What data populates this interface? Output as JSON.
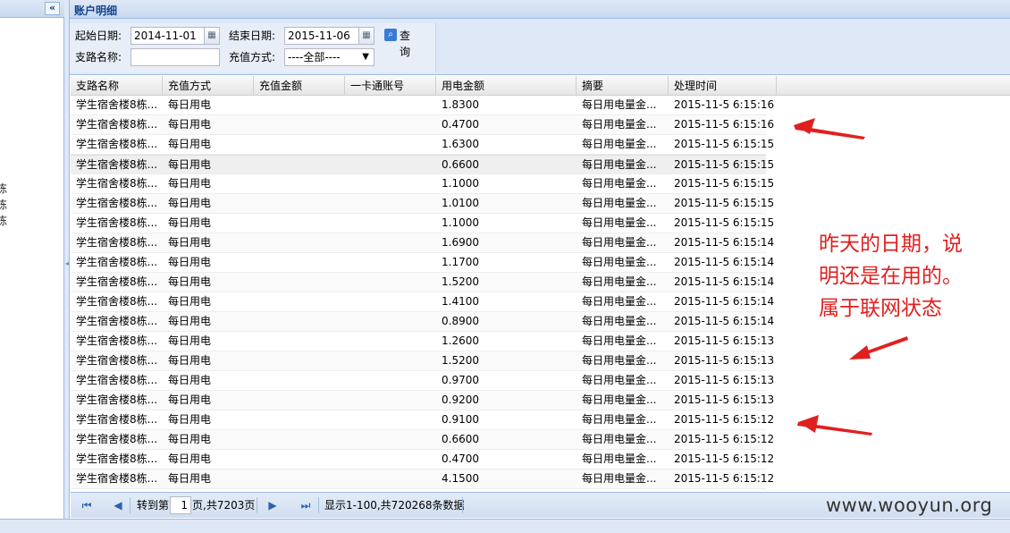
{
  "left_tree": {
    "collapse_icon": "double-chevron-left-icon",
    "items": [
      "",
      "",
      "",
      "",
      "",
      "",
      "",
      "",
      "",
      "",
      "栋",
      "栋",
      "栋"
    ]
  },
  "main": {
    "title": "账户明细"
  },
  "form": {
    "start_label": "起始日期:",
    "start_value": "2014-11-01",
    "end_label": "结束日期:",
    "end_value": "2015-11-06",
    "query_label": "查询",
    "branch_label": "支路名称:",
    "branch_value": "",
    "method_label": "充值方式:",
    "method_value": "----全部----",
    "calendar_icon": "calendar-icon",
    "search_icon": "search-icon"
  },
  "grid": {
    "columns": [
      "支路名称",
      "充值方式",
      "充值金额",
      "一卡通账号",
      "用电金额",
      "摘要",
      "处理时间"
    ],
    "rows": [
      [
        "学生宿舍楼8栋...",
        "每日用电",
        "",
        "",
        "1.8300",
        "每日用电量金...",
        "2015-11-5 6:15:16"
      ],
      [
        "学生宿舍楼8栋...",
        "每日用电",
        "",
        "",
        "0.4700",
        "每日用电量金...",
        "2015-11-5 6:15:16"
      ],
      [
        "学生宿舍楼8栋...",
        "每日用电",
        "",
        "",
        "1.6300",
        "每日用电量金...",
        "2015-11-5 6:15:15"
      ],
      [
        "学生宿舍楼8栋...",
        "每日用电",
        "",
        "",
        "0.6600",
        "每日用电量金...",
        "2015-11-5 6:15:15"
      ],
      [
        "学生宿舍楼8栋...",
        "每日用电",
        "",
        "",
        "1.1000",
        "每日用电量金...",
        "2015-11-5 6:15:15"
      ],
      [
        "学生宿舍楼8栋...",
        "每日用电",
        "",
        "",
        "1.0100",
        "每日用电量金...",
        "2015-11-5 6:15:15"
      ],
      [
        "学生宿舍楼8栋...",
        "每日用电",
        "",
        "",
        "1.1000",
        "每日用电量金...",
        "2015-11-5 6:15:15"
      ],
      [
        "学生宿舍楼8栋...",
        "每日用电",
        "",
        "",
        "1.6900",
        "每日用电量金...",
        "2015-11-5 6:15:14"
      ],
      [
        "学生宿舍楼8栋...",
        "每日用电",
        "",
        "",
        "1.1700",
        "每日用电量金...",
        "2015-11-5 6:15:14"
      ],
      [
        "学生宿舍楼8栋...",
        "每日用电",
        "",
        "",
        "1.5200",
        "每日用电量金...",
        "2015-11-5 6:15:14"
      ],
      [
        "学生宿舍楼8栋...",
        "每日用电",
        "",
        "",
        "1.4100",
        "每日用电量金...",
        "2015-11-5 6:15:14"
      ],
      [
        "学生宿舍楼8栋...",
        "每日用电",
        "",
        "",
        "0.8900",
        "每日用电量金...",
        "2015-11-5 6:15:14"
      ],
      [
        "学生宿舍楼8栋...",
        "每日用电",
        "",
        "",
        "1.2600",
        "每日用电量金...",
        "2015-11-5 6:15:13"
      ],
      [
        "学生宿舍楼8栋...",
        "每日用电",
        "",
        "",
        "1.5200",
        "每日用电量金...",
        "2015-11-5 6:15:13"
      ],
      [
        "学生宿舍楼8栋...",
        "每日用电",
        "",
        "",
        "0.9700",
        "每日用电量金...",
        "2015-11-5 6:15:13"
      ],
      [
        "学生宿舍楼8栋...",
        "每日用电",
        "",
        "",
        "0.9200",
        "每日用电量金...",
        "2015-11-5 6:15:13"
      ],
      [
        "学生宿舍楼8栋...",
        "每日用电",
        "",
        "",
        "0.9100",
        "每日用电量金...",
        "2015-11-5 6:15:12"
      ],
      [
        "学生宿舍楼8栋...",
        "每日用电",
        "",
        "",
        "0.6600",
        "每日用电量金...",
        "2015-11-5 6:15:12"
      ],
      [
        "学生宿舍楼8栋...",
        "每日用电",
        "",
        "",
        "0.4700",
        "每日用电量金...",
        "2015-11-5 6:15:12"
      ],
      [
        "学生宿舍楼8栋...",
        "每日用电",
        "",
        "",
        "4.1500",
        "每日用电量金...",
        "2015-11-5 6:15:12"
      ]
    ],
    "selected_row": 3
  },
  "paging": {
    "first_icon": "first-page-icon",
    "prev_icon": "prev-page-icon",
    "next_icon": "next-page-icon",
    "last_icon": "last-page-icon",
    "goto_label": "转到第",
    "page_value": "1",
    "total_pages_label": "页,共7203页",
    "display_info": "显示1-100,共720268条数据"
  },
  "annotation": {
    "lines": [
      "昨天的日期，说",
      "明还是在用的。",
      "属于联网状态"
    ],
    "color": "#e02020",
    "arrow_icon": "red-arrow-icon"
  },
  "watermark": "www.wooyun.org"
}
